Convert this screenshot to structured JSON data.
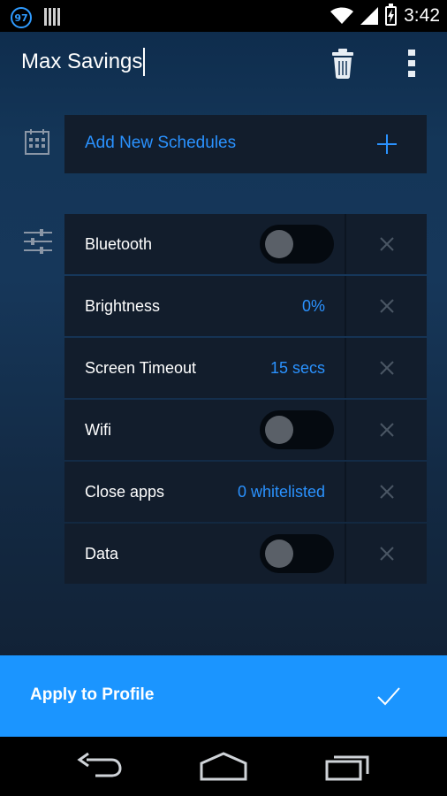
{
  "status_bar": {
    "badge": "97",
    "time": "3:42"
  },
  "header": {
    "title": "Max Savings"
  },
  "schedule": {
    "label": "Add New Schedules"
  },
  "settings": [
    {
      "label": "Bluetooth",
      "type": "toggle",
      "value": "off"
    },
    {
      "label": "Brightness",
      "type": "value",
      "value": "0%"
    },
    {
      "label": "Screen Timeout",
      "type": "value",
      "value": "15 secs"
    },
    {
      "label": "Wifi",
      "type": "toggle",
      "value": "off"
    },
    {
      "label": "Close apps",
      "type": "value",
      "value": "0 whitelisted"
    },
    {
      "label": "Data",
      "type": "toggle",
      "value": "off"
    }
  ],
  "apply": {
    "label": "Apply to Profile"
  },
  "icons": {
    "trash": "trash-icon",
    "more": "more-vert-icon",
    "calendar": "calendar-icon",
    "sliders": "sliders-icon",
    "plus": "plus-icon",
    "remove": "close-icon",
    "check": "check-icon",
    "back": "back-icon",
    "home": "home-icon",
    "recents": "recents-icon"
  },
  "colors": {
    "accent": "#2a92ff",
    "apply_bar": "#1b95ff",
    "card": "#121d2c"
  }
}
